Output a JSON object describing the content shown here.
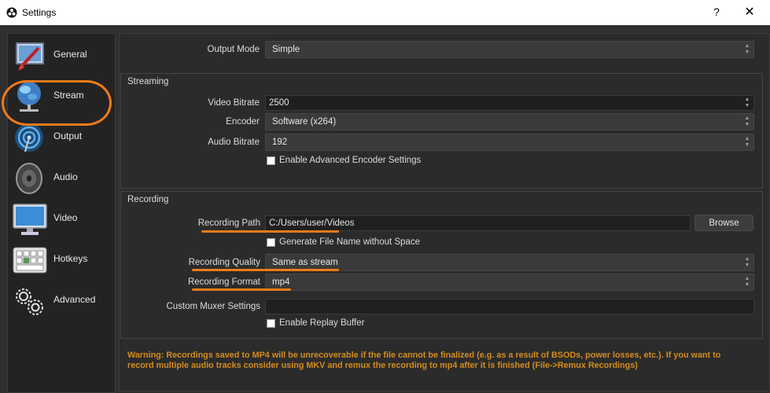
{
  "window": {
    "title": "Settings",
    "help": "?",
    "close": "✕"
  },
  "sidebar": {
    "items": [
      {
        "label": "General",
        "icon": "general-icon"
      },
      {
        "label": "Stream",
        "icon": "globe-icon"
      },
      {
        "label": "Output",
        "icon": "broadcast-icon",
        "selected": true
      },
      {
        "label": "Audio",
        "icon": "speaker-icon"
      },
      {
        "label": "Video",
        "icon": "monitor-icon"
      },
      {
        "label": "Hotkeys",
        "icon": "keyboard-icon"
      },
      {
        "label": "Advanced",
        "icon": "gears-icon"
      }
    ]
  },
  "output_mode": {
    "label": "Output Mode",
    "value": "Simple"
  },
  "streaming": {
    "title": "Streaming",
    "video_bitrate": {
      "label": "Video Bitrate",
      "value": "2500"
    },
    "encoder": {
      "label": "Encoder",
      "value": "Software (x264)"
    },
    "audio_bitrate": {
      "label": "Audio Bitrate",
      "value": "192"
    },
    "advanced_encoder": {
      "label": "Enable Advanced Encoder Settings",
      "checked": false
    }
  },
  "recording": {
    "title": "Recording",
    "path": {
      "label": "Recording Path",
      "value": "C:/Users/user/Videos",
      "browse": "Browse"
    },
    "no_space": {
      "label": "Generate File Name without Space",
      "checked": false
    },
    "quality": {
      "label": "Recording Quality",
      "value": "Same as stream"
    },
    "format": {
      "label": "Recording Format",
      "value": "mp4"
    },
    "muxer": {
      "label": "Custom Muxer Settings",
      "value": ""
    },
    "replay_buffer": {
      "label": "Enable Replay Buffer",
      "checked": false
    }
  },
  "warning": "Warning: Recordings saved to MP4 will be unrecoverable if the file cannot be finalized (e.g. as a result of BSODs, power losses, etc.). If you want to record multiple audio tracks consider using MKV and remux the recording to mp4 after it is finished (File->Remux Recordings)",
  "colors": {
    "accent": "#f07b1a",
    "warning": "#d38c1f",
    "background": "#2b2b2b"
  }
}
